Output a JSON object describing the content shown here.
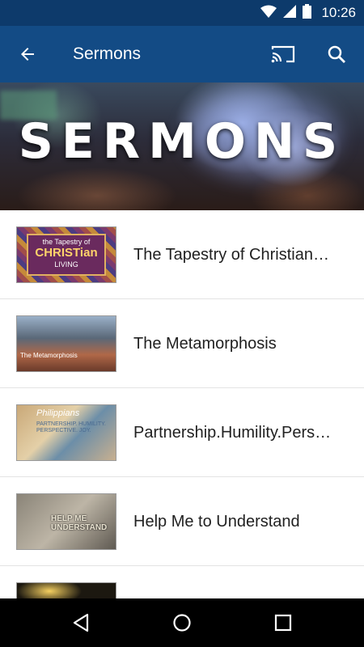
{
  "status_bar": {
    "time": "10:26",
    "icons": [
      "wifi-icon",
      "signal-icon",
      "battery-icon"
    ]
  },
  "app_bar": {
    "title": "Sermons",
    "icons": [
      "back-arrow-icon",
      "cast-icon",
      "search-icon"
    ]
  },
  "hero": {
    "title": "SERMONS"
  },
  "sermons": [
    {
      "title": "The Tapestry of Christian…",
      "thumb_text_top": "the Tapestry of",
      "thumb_text_main": "CHRISTian",
      "thumb_text_bottom": "LIVING"
    },
    {
      "title": "The Metamorphosis",
      "thumb_text": "The Metamorphosis"
    },
    {
      "title": "Partnership.Humility.Pers…",
      "thumb_text": "Philippians",
      "thumb_subtext": "PARTNERSHIP. HUMILITY. PERSPECTIVE. JOY."
    },
    {
      "title": "Help Me to Understand",
      "thumb_text": "HELP ME UNDERSTAND"
    },
    {
      "title": ""
    }
  ],
  "nav_bar": {
    "icons": [
      "back-triangle-icon",
      "home-circle-icon",
      "recents-square-icon"
    ]
  },
  "colors": {
    "status_bar": "#0d3a6b",
    "app_bar": "#134b85",
    "nav_bar": "#000000"
  }
}
